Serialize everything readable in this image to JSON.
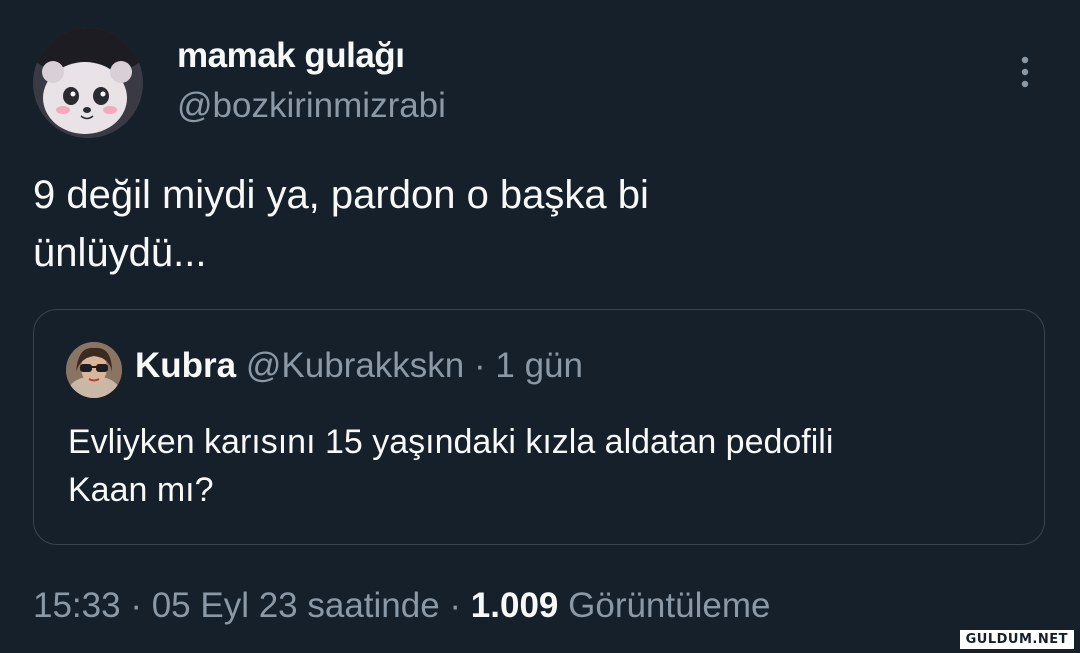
{
  "tweet": {
    "author": {
      "name": "mamak gulağı",
      "handle": "@bozkirinmizrabi"
    },
    "text_line1": "9 değil miydi ya, pardon o başka bi",
    "text_line2": "ünlüydü...",
    "more_icon": "three-dots-vertical-icon"
  },
  "quote": {
    "author": {
      "name": "Kubra",
      "handle": "@Kubrakkskn",
      "separator": " · ",
      "time": "1 gün"
    },
    "text_line1": "Evliyken karısını 15 yaşındaki kızla aldatan pedofili",
    "text_line2": "Kaan mı?"
  },
  "footer": {
    "time": "15:33",
    "sep1": " · ",
    "date": "05 Eyl 23 saatinde",
    "sep2": " · ",
    "views_count": "1.009",
    "views_label": "Görüntüleme"
  },
  "watermark": "GULDUM.NET",
  "colors": {
    "background": "#15202b",
    "primary_text": "#f7f9f9",
    "secondary_text": "#8b98a5",
    "border": "#38444d"
  }
}
